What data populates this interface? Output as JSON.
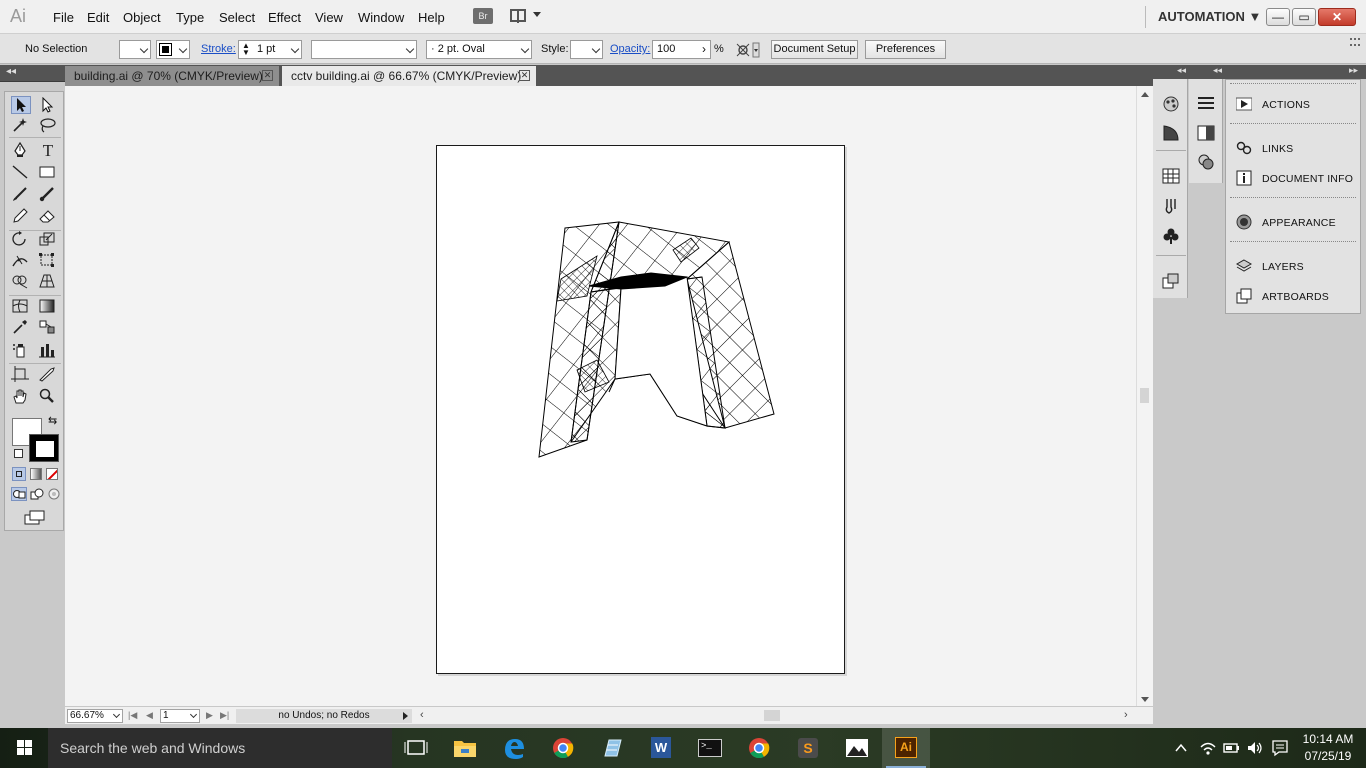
{
  "app": {
    "logo": "Ai",
    "menus": [
      "File",
      "Edit",
      "Object",
      "Type",
      "Select",
      "Effect",
      "View",
      "Window",
      "Help"
    ],
    "bridge_label": "Br",
    "workspace": "AUTOMATION ▼",
    "window_buttons": [
      "—",
      "▭",
      "✕"
    ]
  },
  "control_bar": {
    "selection": "No Selection",
    "stroke_label": "Stroke:",
    "stroke_weight": "1 pt",
    "variable_width": "",
    "brush": "·  2 pt. Oval",
    "style_label": "Style:",
    "opacity_label": "Opacity:",
    "opacity_value": "100",
    "opacity_arrow": "›",
    "percent": "%",
    "document_setup": "Document Setup",
    "preferences": "Preferences"
  },
  "tabs": [
    {
      "label": "building.ai @ 70% (CMYK/Preview)",
      "active": false
    },
    {
      "label": "cctv building.ai @ 66.67% (CMYK/Preview)",
      "active": true
    }
  ],
  "tab_close_glyph": "✕",
  "status_bar": {
    "zoom": "66.67%",
    "artboard_number": "1",
    "status_text": "no Undos; no Redos",
    "nav_first": "|◀",
    "nav_prev": "◀",
    "nav_next": "▶",
    "nav_last": "▶|",
    "scroll_left": "‹",
    "scroll_right": "›"
  },
  "panels": {
    "collapse_glyph": "◂◂",
    "expand_glyph": "▸▸",
    "items": [
      {
        "label": "ACTIONS",
        "icon": "play-icon"
      },
      {
        "label": "LINKS",
        "icon": "link-icon"
      },
      {
        "label": "DOCUMENT INFO",
        "icon": "info-icon"
      },
      {
        "label": "APPEARANCE",
        "icon": "appearance-icon"
      },
      {
        "label": "LAYERS",
        "icon": "layers-icon"
      },
      {
        "label": "ARTBOARDS",
        "icon": "artboards-icon"
      }
    ]
  },
  "taskbar": {
    "search_placeholder": "Search the web and Windows",
    "time": "10:14 AM",
    "date": "07/25/19",
    "apps": [
      "task-view-icon",
      "file-explorer-icon",
      "edge-icon",
      "chrome-icon",
      "remote-app-icon",
      "word-icon",
      "command-prompt-icon",
      "chrome-icon",
      "sublime-icon",
      "photos-icon",
      "illustrator-icon"
    ],
    "word_glyph": "W",
    "ai_glyph": "Ai",
    "sublime_glyph": "S",
    "cmd_glyph": ">_"
  },
  "colors": {
    "canvas": "#f3f3f3",
    "active_tab": "#e9e9e9",
    "panel_bg": "#e2e2e2",
    "taskbar": "#1f2a1c",
    "illustrator_orange": "#f7a21b"
  }
}
